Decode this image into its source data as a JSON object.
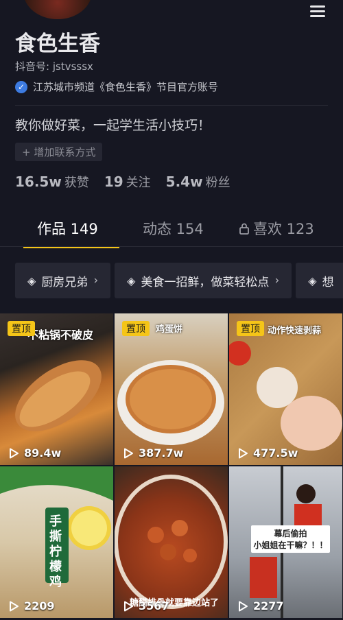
{
  "profile": {
    "name": "食色生香",
    "douyin_id": "抖音号: jstvsssx",
    "verified_text": "江苏城市频道《食色生香》节目官方账号",
    "bio": "教你做好菜，一起学生活小技巧！",
    "add_contact": "+ 增加联系方式"
  },
  "stats": [
    {
      "num": "16.5w",
      "label": "获赞"
    },
    {
      "num": "19",
      "label": "关注"
    },
    {
      "num": "5.4w",
      "label": "粉丝"
    }
  ],
  "tabs": [
    {
      "label": "作品 149"
    },
    {
      "label": "动态 154"
    },
    {
      "label": "喜欢 123"
    }
  ],
  "collections": [
    {
      "label": "厨房兄弟"
    },
    {
      "label": "美食一招鲜，做菜轻松点"
    },
    {
      "label": "想"
    }
  ],
  "videos": [
    {
      "pinned": "置顶",
      "views": "89.4w",
      "caption": "不粘锅不破皮"
    },
    {
      "pinned": "置顶",
      "views": "387.7w",
      "caption": "鸡蛋饼"
    },
    {
      "pinned": "置顶",
      "views": "477.5w",
      "caption": "动作快速剥蒜"
    },
    {
      "views": "2209",
      "caption": "手撕柠檬鸡"
    },
    {
      "views": "3567",
      "caption": "糖醋排骨就要靠边站了"
    },
    {
      "views": "2277",
      "caption": "幕后偷拍\n小姐姐在干嘛？！！"
    }
  ],
  "colors": {
    "accent": "#f5c518",
    "background": "#161722",
    "verified": "#3d7be0"
  }
}
